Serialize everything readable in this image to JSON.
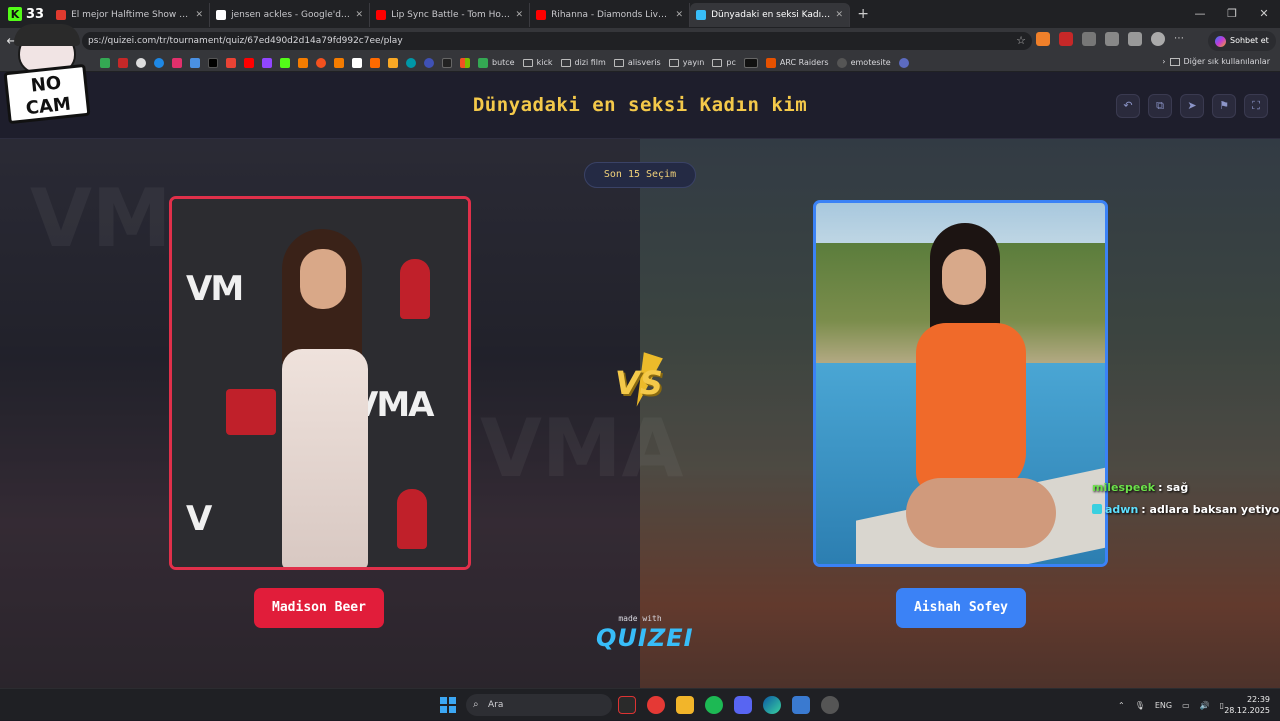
{
  "browser": {
    "kick_count": "33",
    "tabs": [
      {
        "title": "El mejor Halftime Show Super Bowl",
        "color": "#e03a2f",
        "active": false
      },
      {
        "title": "jensen ackles - Google'da Ara",
        "color": "#4285f4",
        "active": false
      },
      {
        "title": "Lip Sync Battle - Tom Holland - Yo",
        "color": "#ff0000",
        "active": false
      },
      {
        "title": "Rihanna - Diamonds Live Victoria's",
        "color": "#ff0000",
        "active": false
      },
      {
        "title": "Dünyadaki en seksi Kadın kim - Ti",
        "color": "#38bdf8",
        "active": true
      }
    ],
    "url": "ps://quizei.com/tr/tournament/quiz/67ed490d2d14a79fd992c7ee/play",
    "copilot_label": "Sohbet et",
    "bookmarks": [
      "butce",
      "kick",
      "dizi film",
      "alisveris",
      "yayın",
      "pc",
      "ARC Raiders",
      "emotesite"
    ],
    "bookmarks_other": "Diğer sık kullanılanlar"
  },
  "overlay": {
    "sign_line1": "NO",
    "sign_line2": "CAM"
  },
  "quiz": {
    "title": "Dünyadaki en seksi Kadın kim",
    "last_badge": "Son 15 Seçim",
    "vs": "VS",
    "left": {
      "name": "Madison Beer",
      "accent": "#e11d3a"
    },
    "right": {
      "name": "Aishah Sofey",
      "accent": "#3b82f6"
    },
    "made_with": "made with",
    "brand": "QUIZEI"
  },
  "chat": [
    {
      "user": "milespeek",
      "message": ": sağ"
    },
    {
      "user": "adwn",
      "message": ": adlara baksan yetiyo"
    }
  ],
  "taskbar": {
    "search_placeholder": "Ara",
    "language": "ENG",
    "time": "22:39",
    "date": "28.12.2025"
  }
}
